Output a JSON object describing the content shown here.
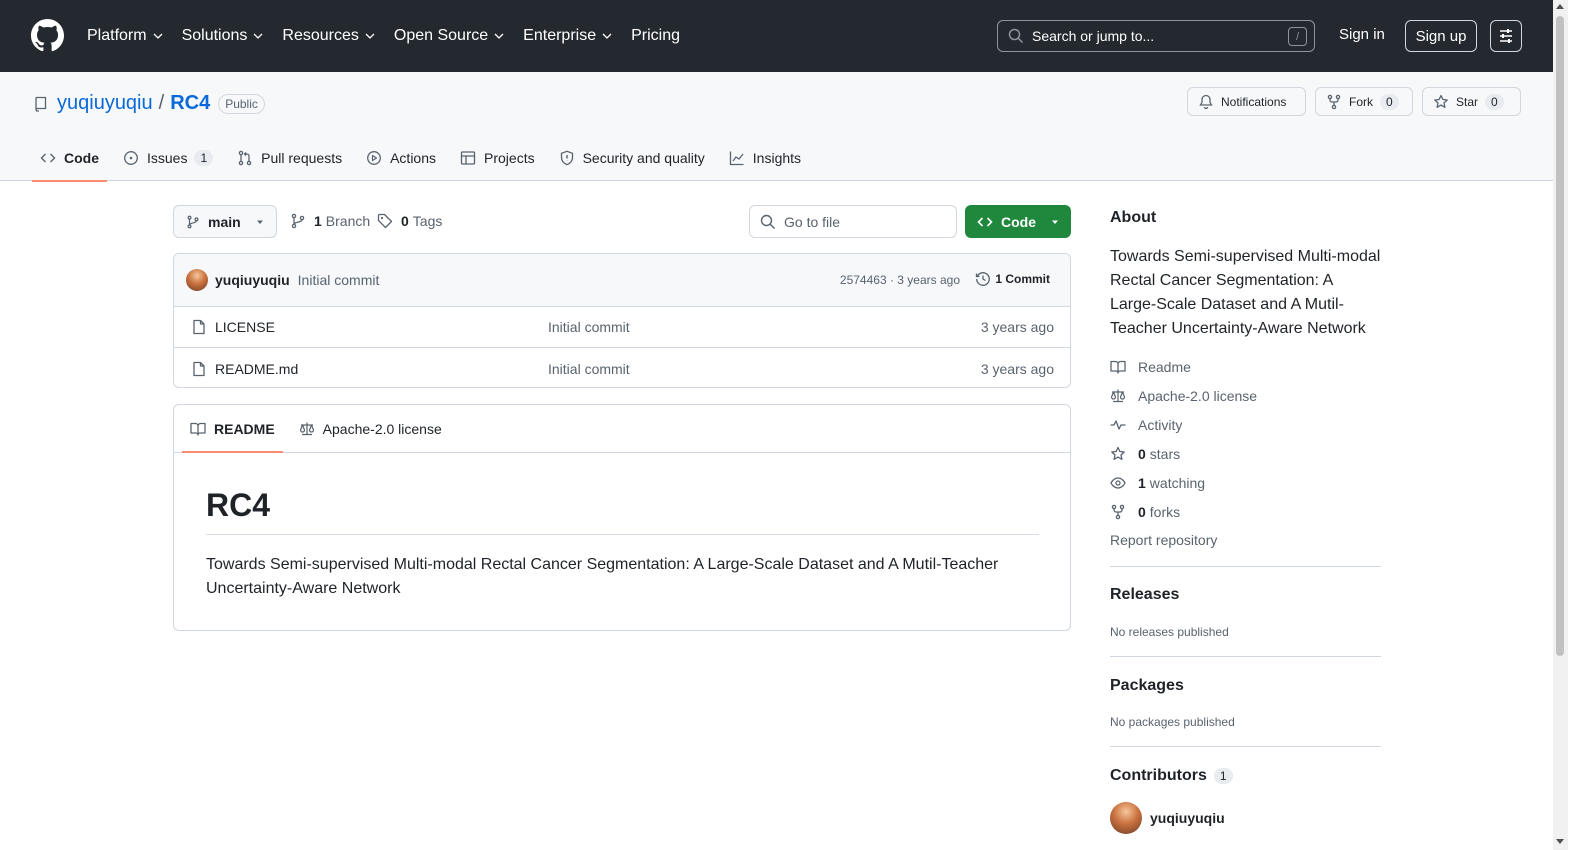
{
  "header": {
    "nav": [
      {
        "label": "Platform",
        "has_menu": true
      },
      {
        "label": "Solutions",
        "has_menu": true
      },
      {
        "label": "Resources",
        "has_menu": true
      },
      {
        "label": "Open Source",
        "has_menu": true
      },
      {
        "label": "Enterprise",
        "has_menu": true
      },
      {
        "label": "Pricing",
        "has_menu": false
      }
    ],
    "search_placeholder": "Search or jump to...",
    "search_shortcut": "/",
    "signin": "Sign in",
    "signup": "Sign up"
  },
  "repo": {
    "owner": "yuqiuyuqiu",
    "separator": "/",
    "name": "RC4",
    "visibility": "Public",
    "notifications_label": "Notifications",
    "fork_label": "Fork",
    "fork_count": "0",
    "star_label": "Star",
    "star_count": "0"
  },
  "tabs": [
    {
      "label": "Code",
      "icon": "code-icon",
      "active": true
    },
    {
      "label": "Issues",
      "icon": "issue-icon",
      "count": "1"
    },
    {
      "label": "Pull requests",
      "icon": "pull-request-icon"
    },
    {
      "label": "Actions",
      "icon": "play-icon"
    },
    {
      "label": "Projects",
      "icon": "table-icon"
    },
    {
      "label": "Security and quality",
      "icon": "shield-icon"
    },
    {
      "label": "Insights",
      "icon": "graph-icon"
    }
  ],
  "toolbar": {
    "branch": "main",
    "branches_count": "1",
    "branches_label": "Branch",
    "tags_count": "0",
    "tags_label": "Tags",
    "goto_file_placeholder": "Go to file",
    "code_button": "Code"
  },
  "latest_commit": {
    "author": "yuqiuyuqiu",
    "message": "Initial commit",
    "meta": "2574463 · 3 years ago",
    "commits_label": "1 Commit"
  },
  "files": [
    {
      "name": "LICENSE",
      "commit": "Initial commit",
      "time": "3 years ago"
    },
    {
      "name": "README.md",
      "commit": "Initial commit",
      "time": "3 years ago"
    }
  ],
  "readme": {
    "tabs": [
      {
        "label": "README",
        "icon": "book-icon",
        "active": true
      },
      {
        "label": "Apache-2.0 license",
        "icon": "law-icon"
      }
    ],
    "heading": "RC4",
    "body": "Towards Semi-supervised Multi-modal Rectal Cancer Segmentation: A Large-Scale Dataset and A Mutil-Teacher Uncertainty-Aware Network"
  },
  "about": {
    "title": "About",
    "description": "Towards Semi-supervised Multi-modal Rectal Cancer Segmentation: A Large-Scale Dataset and A Mutil-Teacher Uncertainty-Aware Network",
    "links": {
      "readme": "Readme",
      "license": "Apache-2.0 license",
      "activity": "Activity",
      "stars_count": "0",
      "stars_label": "stars",
      "watching_count": "1",
      "watching_label": "watching",
      "forks_count": "0",
      "forks_label": "forks"
    },
    "report": "Report repository"
  },
  "releases": {
    "title": "Releases",
    "empty": "No releases published"
  },
  "packages": {
    "title": "Packages",
    "empty": "No packages published"
  },
  "contributors": {
    "title": "Contributors",
    "count": "1",
    "names": [
      "yuqiuyuqiu"
    ]
  },
  "colors": {
    "header_bg": "#24292f",
    "link": "#0969da",
    "primary_button": "#1f883d",
    "tab_underline": "#fd8c73"
  }
}
